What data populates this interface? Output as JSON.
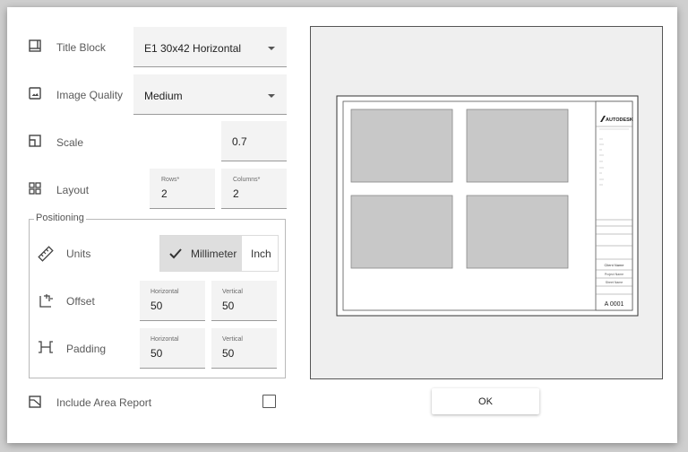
{
  "title_block": {
    "label": "Title Block",
    "value": "E1 30x42 Horizontal",
    "icon": "title-block-icon"
  },
  "image_quality": {
    "label": "Image Quality",
    "value": "Medium",
    "icon": "image-icon"
  },
  "scale": {
    "label": "Scale",
    "value": "0.7",
    "icon": "scale-icon"
  },
  "layout": {
    "label": "Layout",
    "rows_label": "Rows*",
    "rows_value": "2",
    "cols_label": "Columns*",
    "cols_value": "2",
    "icon": "grid-icon"
  },
  "positioning": {
    "legend": "Positioning",
    "units": {
      "label": "Units",
      "options": [
        "Millimeter",
        "Inch"
      ],
      "selected": "Millimeter",
      "icon": "ruler-icon"
    },
    "offset": {
      "label": "Offset",
      "h_label": "Horizontal",
      "h_value": "50",
      "v_label": "Vertical",
      "v_value": "50",
      "icon": "offset-icon"
    },
    "padding": {
      "label": "Padding",
      "h_label": "Horizontal",
      "h_value": "50",
      "v_label": "Vertical",
      "v_value": "50",
      "icon": "padding-icon"
    }
  },
  "area_report": {
    "label": "Include Area Report",
    "checked": false,
    "icon": "area-report-icon"
  },
  "preview": {
    "brand": "AUTODESK",
    "client_name": "Client Name",
    "project_name": "Project Name",
    "sheet_name": "Sheet Name",
    "sheet_number": "A 0001"
  },
  "ok_label": "OK"
}
